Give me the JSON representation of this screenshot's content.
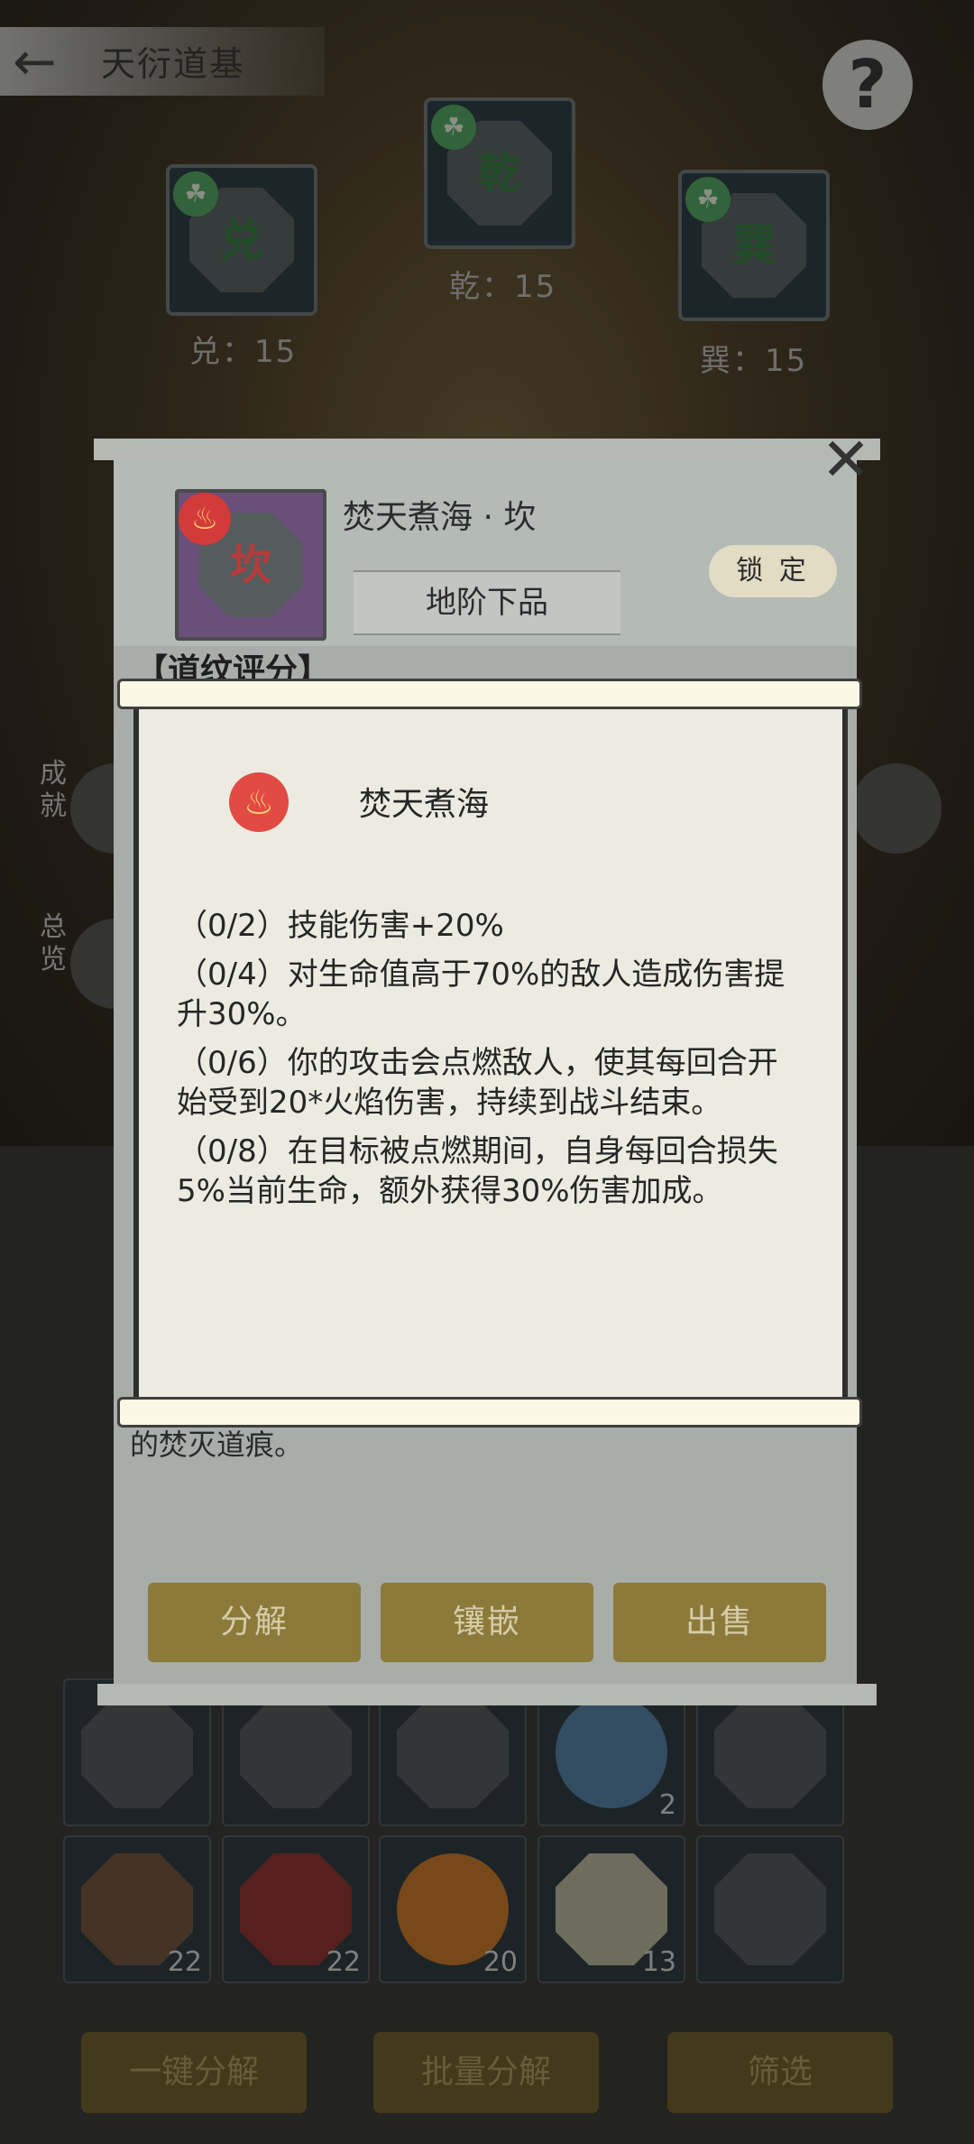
{
  "header": {
    "title": "天衍道基"
  },
  "trigrams": [
    {
      "label": "兑：15",
      "rune": "兑"
    },
    {
      "label": "乾：15",
      "rune": "乾"
    },
    {
      "label": "巽：15",
      "rune": "巽"
    }
  ],
  "side_menu": [
    {
      "label": "成就"
    },
    {
      "label": "总览"
    }
  ],
  "item": {
    "name": "焚天煮海 · 坎",
    "rune": "坎",
    "grade": "地阶下品",
    "lock_label": "锁 定"
  },
  "section": {
    "heading": "【道纹评分】"
  },
  "set_bonus": {
    "name": "焚天煮海",
    "effects": [
      "（0/2）技能伤害+20%",
      "（0/4）对生命值高于70%的敌人造成伤害提升30%。",
      "（0/6）你的攻击会点燃敌人，使其每回合开始受到20*火焰伤害，持续到战斗结束。",
      "（0/8）在目标被点燃期间，自身每回合损失5%当前生命，额外获得30%伤害加成。"
    ]
  },
  "description_tail": "的焚灭道痕。",
  "popup_actions": {
    "decompose": "分解",
    "inlay": "镶嵌",
    "sell": "出售"
  },
  "inventory": {
    "counts": [
      "2",
      "22",
      "22",
      "20",
      "13"
    ]
  },
  "bottom_actions": {
    "one_click": "一键分解",
    "batch": "批量分解",
    "filter": "筛选"
  },
  "colors": {
    "gold_button": "#8b7a3a",
    "scroll_paper": "#ecebe1",
    "fire_badge": "#e24a44"
  }
}
